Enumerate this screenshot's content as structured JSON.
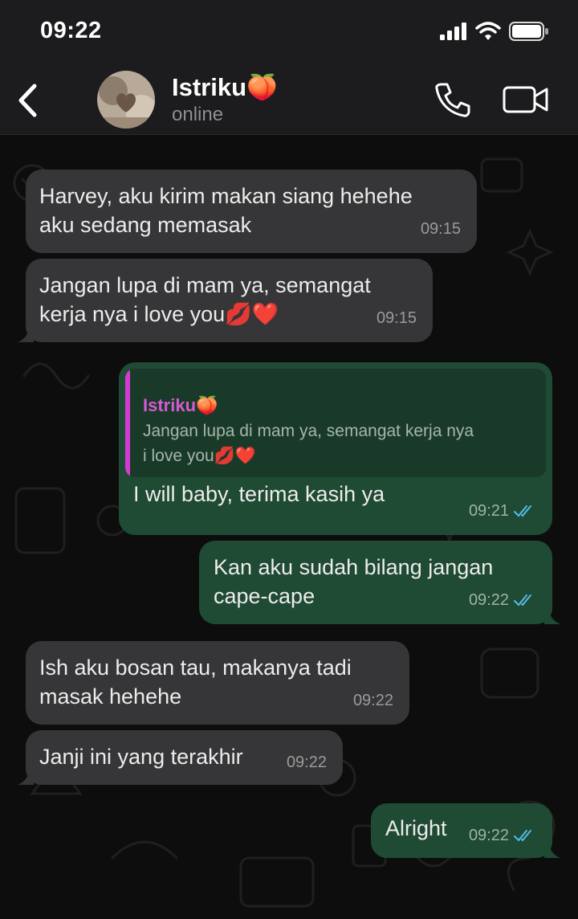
{
  "status_bar": {
    "time": "09:22"
  },
  "header": {
    "contact_name": "Istriku🍑",
    "contact_status": "online"
  },
  "icons": {
    "back": "chevron-left-icon",
    "call": "phone-icon",
    "video": "video-camera-icon",
    "signal": "signal-icon",
    "wifi": "wifi-icon",
    "battery": "battery-icon",
    "read": "double-check-icon"
  },
  "colors": {
    "incoming_bubble": "#363638",
    "outgoing_bubble": "#1f4a33",
    "read_ticks": "#53bdeb",
    "quote_accent": "#d63ad6"
  },
  "messages": [
    {
      "direction": "in",
      "text_line1": "Harvey, aku kirim makan siang hehehe",
      "text_line2": "aku sedang memasak",
      "time": "09:15"
    },
    {
      "direction": "in",
      "text_line1": "Jangan lupa di mam ya, semangat",
      "text_line2": "kerja nya i love you💋❤️",
      "time": "09:15"
    },
    {
      "direction": "out",
      "quote_name": "Istriku🍑",
      "quote_line1": "Jangan lupa di mam ya, semangat kerja nya",
      "quote_line2": "i love you💋❤️",
      "text_line1": "I will baby, terima kasih ya",
      "time": "09:21",
      "read": true
    },
    {
      "direction": "out",
      "text_line1": "Kan aku sudah bilang jangan",
      "text_line2": "cape-cape",
      "time": "09:22",
      "read": true
    },
    {
      "direction": "in",
      "text_line1": "Ish aku bosan tau, makanya tadi",
      "text_line2": "masak hehehe",
      "time": "09:22"
    },
    {
      "direction": "in",
      "text_line1": "Janji ini yang terakhir",
      "time": "09:22"
    },
    {
      "direction": "out",
      "text_line1": "Alright",
      "time": "09:22",
      "read": true
    }
  ]
}
